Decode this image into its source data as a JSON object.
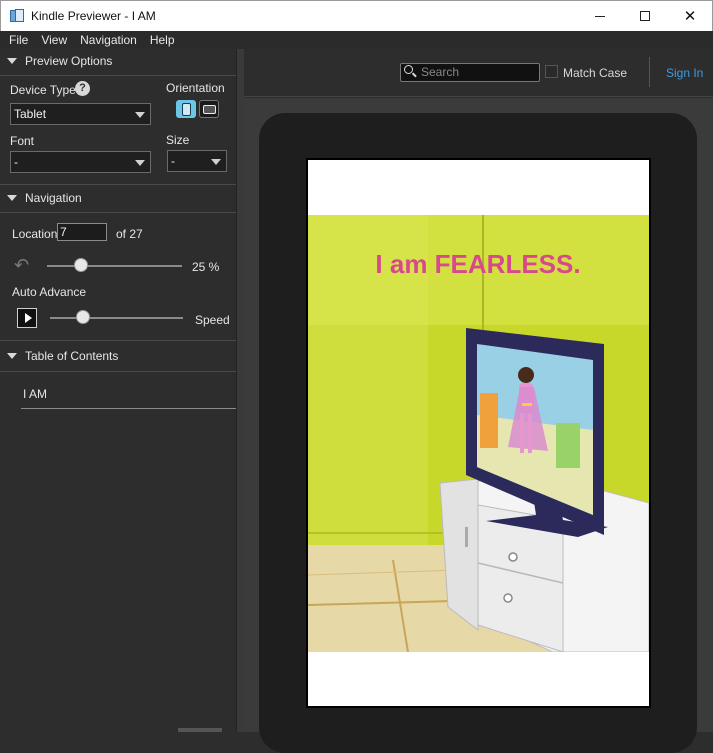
{
  "window": {
    "title": "Kindle Previewer - I AM",
    "minimize": "minimize",
    "maximize": "maximize",
    "close": "✕"
  },
  "menu": {
    "items": [
      "File",
      "View",
      "Navigation",
      "Help"
    ]
  },
  "preview_options": {
    "header": "Preview Options",
    "device_type_label": "Device Type",
    "help_glyph": "?",
    "device_type_value": "Tablet",
    "orientation_label": "Orientation",
    "font_label": "Font",
    "font_value": "-",
    "size_label": "Size",
    "size_value": "-"
  },
  "navigation": {
    "header": "Navigation",
    "location_label": "Location",
    "location_value": "7",
    "location_total": "of 27",
    "progress_percent": "25 %",
    "progress_fraction": 0.25,
    "auto_advance_label": "Auto Advance",
    "speed_label": "Speed",
    "speed_fraction": 0.25
  },
  "toc": {
    "header": "Table of Contents",
    "items": [
      "I AM"
    ]
  },
  "toolbar": {
    "search_placeholder": "Search",
    "match_case_label": "Match Case",
    "sign_in_label": "Sign In"
  },
  "page": {
    "headline": "I am FEARLESS.",
    "colors": {
      "wall": "#c9d92a",
      "floor": "#e6d7a6",
      "headline": "#d9488f",
      "tv_frame": "#2c2a5a"
    }
  },
  "icons": {
    "app": "kindle-previewer-icon",
    "help": "help-icon",
    "portrait": "portrait-orientation-icon",
    "landscape": "landscape-orientation-icon",
    "back": "back-arrow-icon",
    "play": "play-icon",
    "search": "search-icon"
  }
}
